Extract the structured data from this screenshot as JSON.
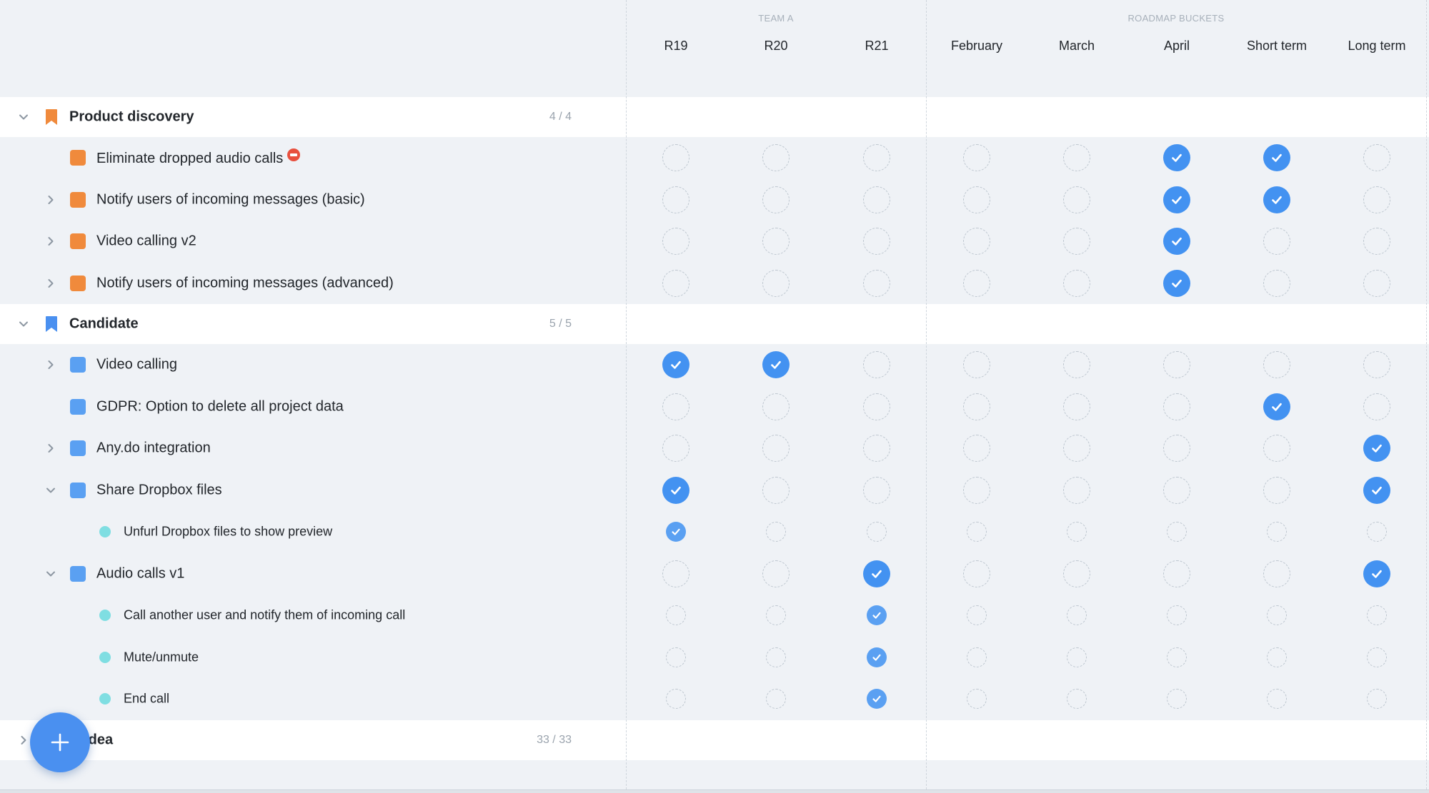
{
  "header": {
    "groups": [
      {
        "label": "TEAM A"
      },
      {
        "label": "ROADMAP BUCKETS"
      }
    ],
    "columns": [
      "R19",
      "R20",
      "R21",
      "February",
      "March",
      "April",
      "Short term",
      "Long term"
    ]
  },
  "rows": [
    {
      "kind": "group",
      "label": "Product discovery",
      "count": "4 / 4",
      "color": "#f08a3c",
      "expanded": true,
      "icon": "bookmark-icon"
    },
    {
      "kind": "item",
      "label": "Eliminate dropped audio calls",
      "color": "#f08a3c",
      "chevron": "none",
      "blocked": true,
      "checks": [
        0,
        0,
        0,
        0,
        0,
        1,
        1,
        0
      ]
    },
    {
      "kind": "item",
      "label": "Notify users of incoming messages (basic)",
      "color": "#f08a3c",
      "chevron": "right",
      "checks": [
        0,
        0,
        0,
        0,
        0,
        1,
        1,
        0
      ]
    },
    {
      "kind": "item",
      "label": "Video calling v2",
      "color": "#f08a3c",
      "chevron": "right",
      "checks": [
        0,
        0,
        0,
        0,
        0,
        1,
        0,
        0
      ]
    },
    {
      "kind": "item",
      "label": "Notify users of incoming messages (advanced)",
      "color": "#f08a3c",
      "chevron": "right",
      "checks": [
        0,
        0,
        0,
        0,
        0,
        1,
        0,
        0
      ]
    },
    {
      "kind": "group",
      "label": "Candidate",
      "count": "5 / 5",
      "color": "#4a90f0",
      "expanded": true,
      "icon": "bookmark-icon"
    },
    {
      "kind": "item",
      "label": "Video calling",
      "color": "#5aa0f2",
      "chevron": "right",
      "checks": [
        1,
        1,
        0,
        0,
        0,
        0,
        0,
        0
      ]
    },
    {
      "kind": "item",
      "label": "GDPR: Option to delete all project data",
      "color": "#5aa0f2",
      "chevron": "none",
      "checks": [
        0,
        0,
        0,
        0,
        0,
        0,
        1,
        0
      ]
    },
    {
      "kind": "item",
      "label": "Any.do integration",
      "color": "#5aa0f2",
      "chevron": "right",
      "checks": [
        0,
        0,
        0,
        0,
        0,
        0,
        0,
        1
      ]
    },
    {
      "kind": "item",
      "label": "Share Dropbox files",
      "color": "#5aa0f2",
      "chevron": "down",
      "checks": [
        1,
        0,
        0,
        0,
        0,
        0,
        0,
        1
      ]
    },
    {
      "kind": "subitem",
      "label": "Unfurl Dropbox files to show preview",
      "color": "#7fdee2",
      "checks": [
        1,
        0,
        0,
        0,
        0,
        0,
        0,
        0
      ]
    },
    {
      "kind": "item",
      "label": "Audio calls v1",
      "color": "#5aa0f2",
      "chevron": "down",
      "checks": [
        0,
        0,
        1,
        0,
        0,
        0,
        0,
        1
      ]
    },
    {
      "kind": "subitem",
      "label": "Call another user and notify them of incoming call",
      "color": "#7fdee2",
      "checks": [
        0,
        0,
        1,
        0,
        0,
        0,
        0,
        0
      ]
    },
    {
      "kind": "subitem",
      "label": "Mute/unmute",
      "color": "#7fdee2",
      "checks": [
        0,
        0,
        1,
        0,
        0,
        0,
        0,
        0
      ]
    },
    {
      "kind": "subitem",
      "label": "End call",
      "color": "#7fdee2",
      "checks": [
        0,
        0,
        1,
        0,
        0,
        0,
        0,
        0
      ]
    },
    {
      "kind": "group",
      "label": "New Idea",
      "count": "33 / 33",
      "color": "#4a90f0",
      "expanded": false,
      "noIcon": true,
      "visible_label": "w Idea"
    }
  ],
  "fab": {
    "icon": "plus-icon"
  }
}
